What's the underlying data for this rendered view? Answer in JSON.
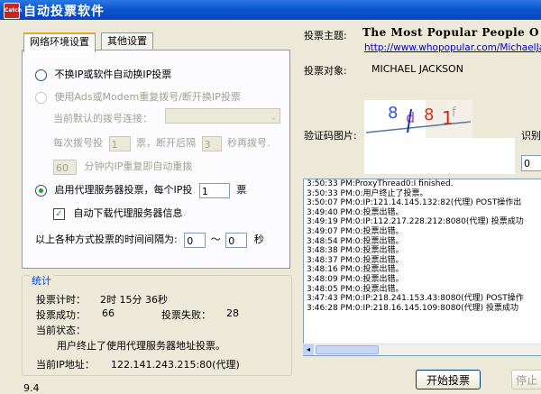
{
  "window": {
    "title": "自动投票软件",
    "icon_text": "Catch"
  },
  "tabs": [
    {
      "label": "网络环境设置",
      "active": true
    },
    {
      "label": "其他设置",
      "active": false
    }
  ],
  "network": {
    "option_no_ip_change": "不换IP或软件自动换IP投票",
    "option_adsl_redial": "使用Ads或Modem重复拨号/断开换IP投票",
    "default_dial_label": "当前默认的拨号连接：",
    "dial_each_prefix": "每次拨号投",
    "dial_each_value": "1",
    "dial_each_mid": "票，断开后隔",
    "dial_wait_value": "3",
    "dial_wait_suffix": "秒再拨号.",
    "redial_minutes_value": "60",
    "redial_minutes_suffix": "分钟内IP重复即自动重拨",
    "option_proxy": "启用代理服务器投票，每个IP投",
    "proxy_votes_value": "1",
    "proxy_votes_unit": "票",
    "auto_download_proxy": "自动下载代理服务器信息",
    "interval_label": "以上各种方式投票的时间间隔为:",
    "interval_from": "0",
    "interval_sep": "～",
    "interval_to": "0",
    "interval_unit": "秒"
  },
  "stats": {
    "legend": "统计",
    "timer_label": "投票计时：",
    "timer_value": "2时 15分 36秒",
    "success_label": "投票成功：",
    "success_value": "66",
    "fail_label": "投票失败：",
    "fail_value": "28",
    "status_label": "当前状态：",
    "status_value": "用户终止了使用代理服务器地址投票。",
    "ip_label": "当前IP地址：",
    "ip_value": "122.141.243.215:80(代理)"
  },
  "vote": {
    "topic_label": "投票主题:",
    "topic_value": "The Most Popular People O",
    "topic_url": "http://www.whopopular.com/MichaelJa",
    "target_label": "投票对象:",
    "target_value": "MICHAEL JACKSON",
    "captcha_label": "验证码图片:",
    "captcha_chars": "8d81f",
    "recognize_label": "识别",
    "recognize_value": "0"
  },
  "log": [
    "3:50:33 PM:ProxyThread0:I finished.",
    "3:50:33 PM:0:用户终止了投票。",
    "3:50:07 PM:0:IP:121.14.145.132:82(代理) POST操作出",
    "3:49:40 PM:0:投票出错。",
    "3:49:19 PM:0:IP:112.217.228.212:8080(代理) 投票成功",
    "3:49:07 PM:0:投票出错。",
    "3:48:54 PM:0:投票出错。",
    "3:48:38 PM:0:投票出错。",
    "3:48:37 PM:0:投票出错。",
    "3:48:16 PM:0:投票出错。",
    "3:48:09 PM:0:投票出错。",
    "3:48:05 PM:0:投票出错。",
    "3:47:43 PM:0:IP:218.241.153.43:8080(代理) POST操作",
    "3:46:28 PM:0:IP:218.16.145.109:8080(代理) 投票成功"
  ],
  "buttons": {
    "start": "开始投票",
    "stop": "停止"
  },
  "version": "9.4"
}
